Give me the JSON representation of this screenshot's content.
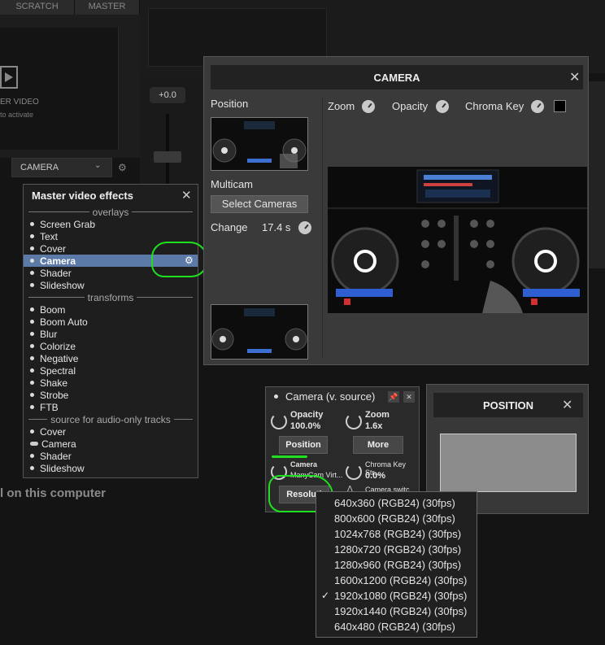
{
  "background": {
    "tabs": [
      {
        "label": "SCRATCH"
      },
      {
        "label": "MASTER"
      }
    ],
    "video_label": "ER VIDEO",
    "video_sublabel": "to activate",
    "gain_pill": "+0.0",
    "camera_select": "CAMERA",
    "computer_text": "l on this computer"
  },
  "master_effects": {
    "title": "Master video effects",
    "sections": [
      {
        "header": "overlays",
        "items": [
          {
            "label": "Screen Grab",
            "marker": "dot"
          },
          {
            "label": "Text",
            "marker": "dot"
          },
          {
            "label": "Cover",
            "marker": "dot"
          },
          {
            "label": "Camera",
            "marker": "dot",
            "selected": true,
            "gear": true
          },
          {
            "label": "Shader",
            "marker": "dot"
          },
          {
            "label": "Slideshow",
            "marker": "dot"
          }
        ]
      },
      {
        "header": "transforms",
        "items": [
          {
            "label": "Boom",
            "marker": "dot"
          },
          {
            "label": "Boom Auto",
            "marker": "dot"
          },
          {
            "label": "Blur",
            "marker": "dot"
          },
          {
            "label": "Colorize",
            "marker": "dot"
          },
          {
            "label": "Negative",
            "marker": "dot"
          },
          {
            "label": "Spectral",
            "marker": "dot"
          },
          {
            "label": "Shake",
            "marker": "dot"
          },
          {
            "label": "Strobe",
            "marker": "dot"
          },
          {
            "label": "FTB",
            "marker": "dot"
          }
        ]
      },
      {
        "header": "source for audio-only tracks",
        "items": [
          {
            "label": "Cover",
            "marker": "dot"
          },
          {
            "label": "Camera",
            "marker": "pill"
          },
          {
            "label": "Shader",
            "marker": "dot"
          },
          {
            "label": "Slideshow",
            "marker": "dot"
          }
        ]
      }
    ]
  },
  "camera_panel": {
    "title": "CAMERA",
    "position_label": "Position",
    "multicam_label": "Multicam",
    "select_cameras": "Select Cameras",
    "change_label": "Change",
    "change_value": "17.4 s",
    "zoom_label": "Zoom",
    "opacity_label": "Opacity",
    "chroma_key_label": "Chroma Key",
    "chroma_color": "#000000"
  },
  "vsource_panel": {
    "title": "Camera (v. source)",
    "opacity_label": "Opacity",
    "opacity_value": "100.0%",
    "zoom_label": "Zoom",
    "zoom_value": "1.6x",
    "position_btn": "Position",
    "more_btn": "More",
    "camera_label": "Camera",
    "camera_value": "ManyCam Virt...",
    "chroma_label": "Chroma Key Str...",
    "chroma_value": "0.0%",
    "resolution_btn": "Resoluti",
    "camera_switch_label": "Camera switc..."
  },
  "position_panel": {
    "title": "POSITION"
  },
  "resolution_menu": {
    "options": [
      {
        "label": "640x360 (RGB24) (30fps)",
        "checked": false
      },
      {
        "label": "800x600 (RGB24) (30fps)",
        "checked": false
      },
      {
        "label": "1024x768 (RGB24) (30fps)",
        "checked": false
      },
      {
        "label": "1280x720 (RGB24) (30fps)",
        "checked": false
      },
      {
        "label": "1280x960 (RGB24) (30fps)",
        "checked": false
      },
      {
        "label": "1600x1200 (RGB24) (30fps)",
        "checked": false
      },
      {
        "label": "1920x1080 (RGB24) (30fps)",
        "checked": true
      },
      {
        "label": "1920x1440 (RGB24) (30fps)",
        "checked": false
      },
      {
        "label": "640x480 (RGB24) (30fps)",
        "checked": false
      }
    ]
  },
  "colors": {
    "selection": "#5c7aa8",
    "annotation": "#1ee01e"
  }
}
